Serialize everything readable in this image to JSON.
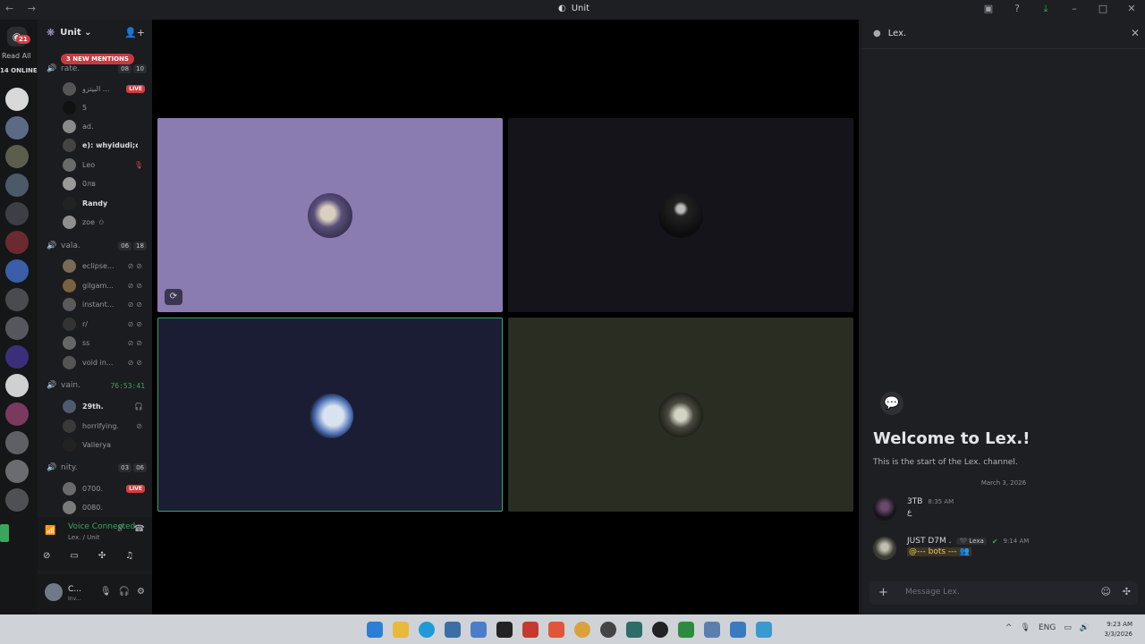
{
  "titlebar": {
    "title": "Unit",
    "nav": "← →"
  },
  "servers": {
    "home_badge": "21",
    "read_all": "Read All",
    "online": "14 ONLINE"
  },
  "guild": {
    "name": "Unit ⌄",
    "mentions_pill": "3 NEW MENTIONS"
  },
  "channels": [
    {
      "name": "rate.",
      "counts": [
        "08",
        "10"
      ]
    },
    {
      "name": "vala.",
      "counts": [
        "06",
        "18"
      ]
    },
    {
      "name": "vain.",
      "timer": "76:53:41"
    },
    {
      "name": "nity.",
      "counts": [
        "03",
        "06"
      ]
    }
  ],
  "users": {
    "rate": [
      "البيتزو ...",
      "5",
      "ad.",
      "e): whyidudi;c...",
      "Leo",
      "0лв",
      "Randy",
      "zoe"
    ],
    "vala": [
      "eclipse...",
      "gilgam...",
      "instant...",
      "r/",
      "ss",
      "void in..."
    ],
    "vain": [
      "29th.",
      "horrifying.",
      "Vallerya"
    ],
    "nity": [
      "0700.",
      "0080."
    ]
  },
  "live_label": "LIVE",
  "voice": {
    "status": "Voice Connected",
    "location": "Lex. / Unit"
  },
  "user": {
    "name": "C...",
    "status": "Inv..."
  },
  "panel": {
    "title": "Lex.",
    "welcome": "Welcome to Lex.!",
    "welcome_sub": "This is the start of the Lex. channel.",
    "date": "March 3, 2026",
    "messages": [
      {
        "author": "3TB",
        "time": "8:35 AM",
        "tag": "",
        "body": "ع"
      },
      {
        "author": "JUST D7M .",
        "time": "9:14 AM",
        "tag": "🖤 Lexa",
        "body": "@--- bots --- 👥"
      }
    ],
    "composer_placeholder": "Message Lex."
  },
  "taskbar": {
    "lang": "ENG",
    "time": "9:23 AM",
    "date": "3/3/2026"
  },
  "colors": {
    "accent_green": "#3ba55d",
    "live_red": "#d23c43",
    "tile1": "#8a7bb1",
    "tile2": "#16141b",
    "tile3": "#1a1d33",
    "tile4": "#2a2e22"
  }
}
